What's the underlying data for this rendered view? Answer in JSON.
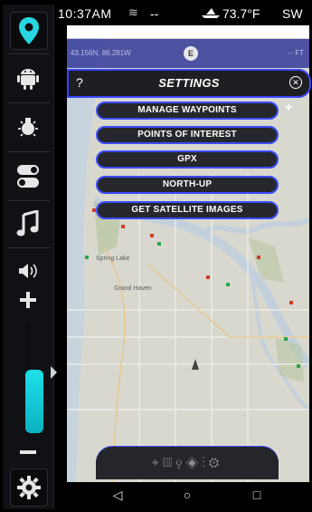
{
  "status_bar": {
    "time": "10:37AM",
    "waves_value": "--",
    "temperature": "73.7°F",
    "heading": "SW"
  },
  "coords_bar": {
    "coordinates": "43.156N, 86.281W",
    "compass_badge": "E",
    "depth": "-- FT"
  },
  "settings": {
    "help": "?",
    "title": "SETTINGS",
    "close": "⊗"
  },
  "menu": [
    {
      "label": "MANAGE WAYPOINTS"
    },
    {
      "label": "POINTS OF INTEREST"
    },
    {
      "label": "GPX"
    },
    {
      "label": "NORTH-UP"
    },
    {
      "label": "GET SATELLITE IMAGES"
    }
  ],
  "map_labels": {
    "city1": "Grand Haven",
    "city2": "Spring Lake"
  },
  "rail_icons": [
    "location-pin-icon",
    "android-icon",
    "light-bulb-icon",
    "toggle-icon",
    "music-note-icon",
    "speaker-icon",
    "plus-icon",
    "minus-icon",
    "gear-icon"
  ],
  "toolbar_icons": [
    "crosshair-icon",
    "map-icon",
    "pin-icon",
    "layers-icon",
    "route-icon",
    "gear-icon"
  ],
  "nav": {
    "back": "◁",
    "home": "○",
    "recent": "□"
  },
  "accent": "#3b4bff",
  "volume_level": 0.55
}
